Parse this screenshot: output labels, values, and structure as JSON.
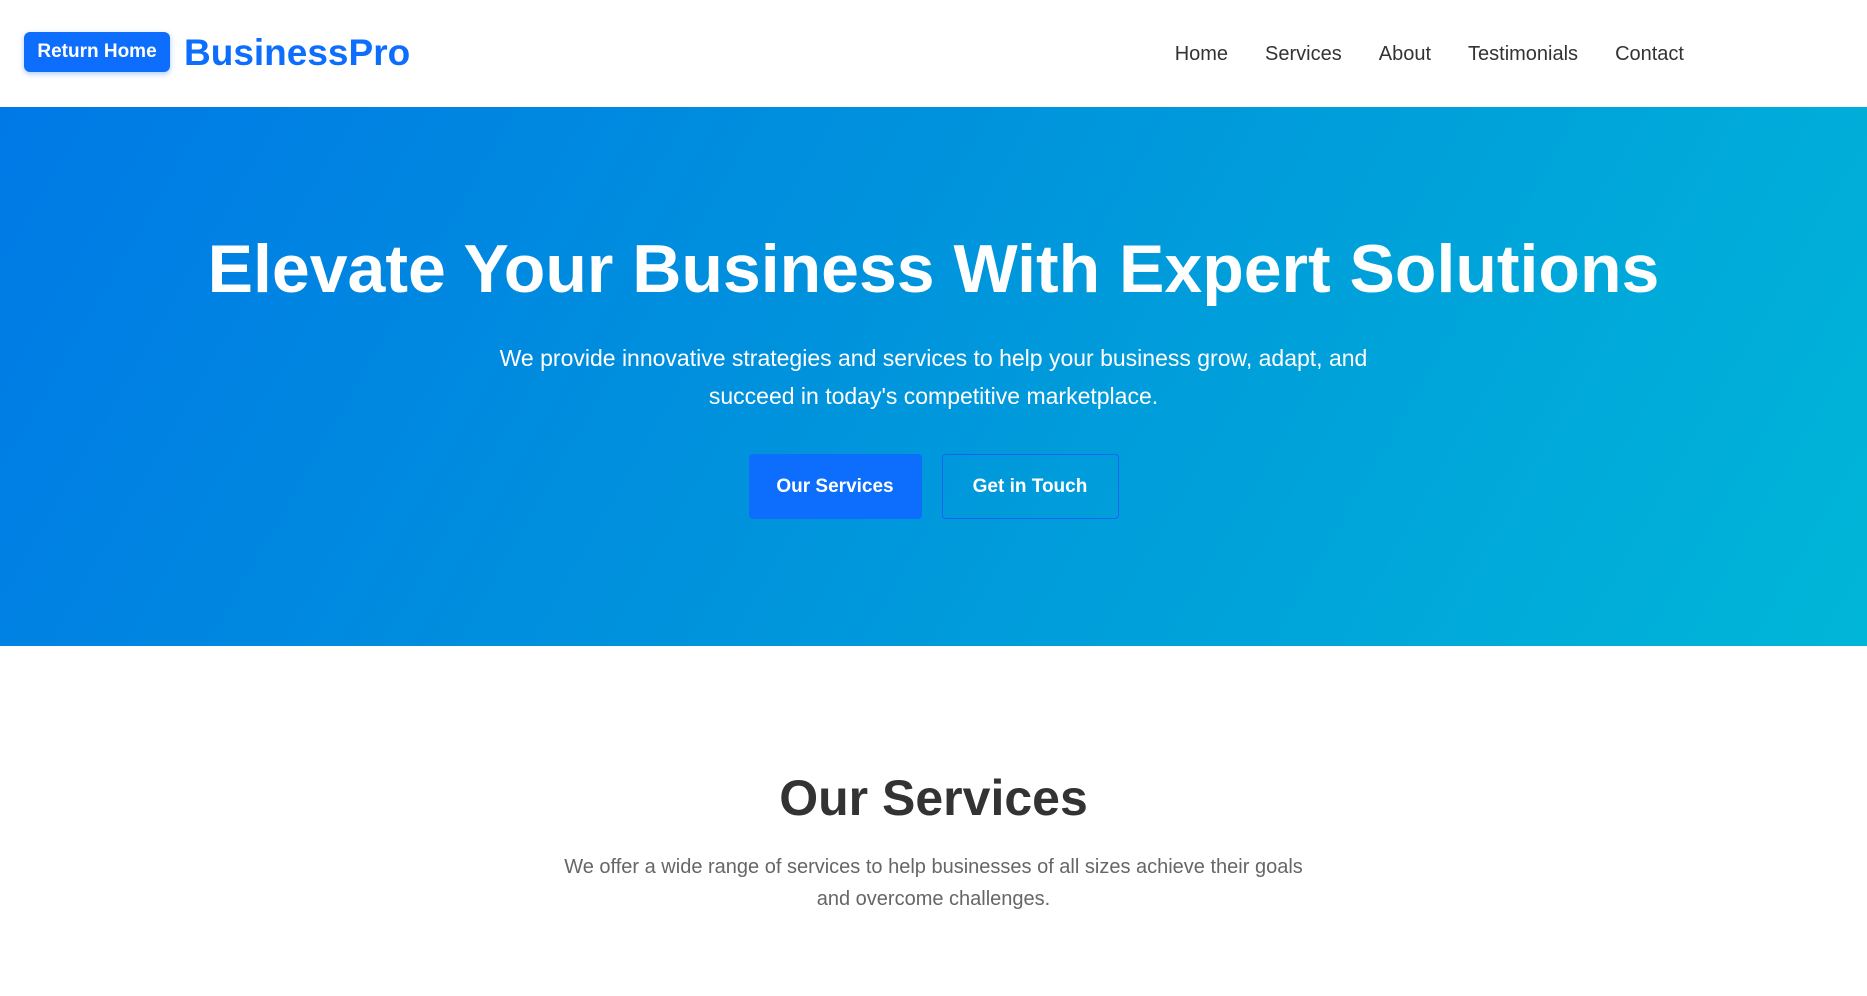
{
  "header": {
    "return_home_label": "Return Home",
    "brand": "BusinessPro",
    "nav": [
      {
        "label": "Home"
      },
      {
        "label": "Services"
      },
      {
        "label": "About"
      },
      {
        "label": "Testimonials"
      },
      {
        "label": "Contact"
      }
    ]
  },
  "hero": {
    "title": "Elevate Your Business With Expert Solutions",
    "subtitle": "We provide innovative strategies and services to help your business grow, adapt, and succeed in today's competitive marketplace.",
    "primary_button": "Our Services",
    "secondary_button": "Get in Touch"
  },
  "services": {
    "title": "Our Services",
    "subtitle": "We offer a wide range of services to help businesses of all sizes achieve their goals and overcome challenges."
  },
  "colors": {
    "accent": "#0d6efd",
    "hero_gradient_start": "#0079e6",
    "hero_gradient_end": "#00b6d8",
    "text_dark": "#333333",
    "text_muted": "#666666"
  }
}
